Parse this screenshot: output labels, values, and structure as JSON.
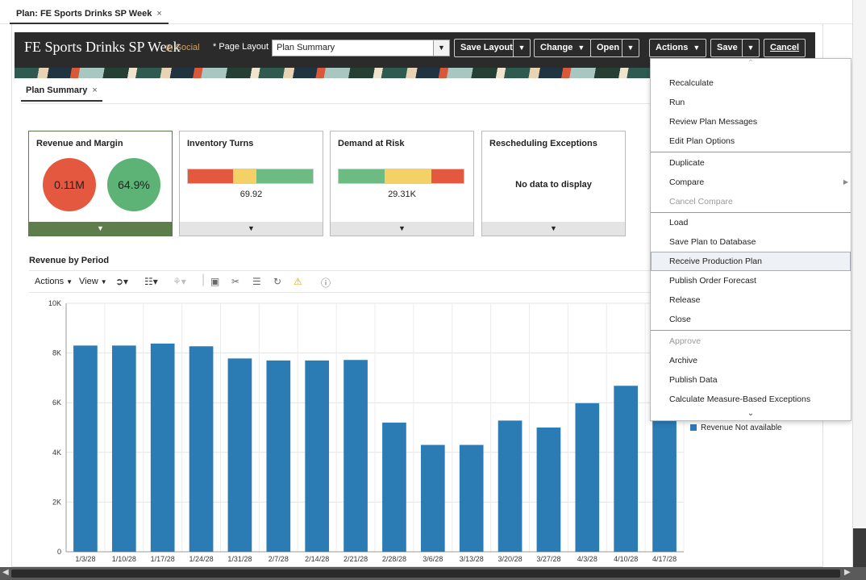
{
  "outer_tab": {
    "label": "Plan: FE Sports Drinks SP Week",
    "close": "×"
  },
  "header": {
    "title": "FE Sports Drinks SP Week",
    "social": "Social",
    "layout_label": "* Page Layout",
    "layout_value": "Plan Summary",
    "buttons": {
      "save_layout": "Save Layout",
      "change": "Change",
      "open": "Open",
      "actions": "Actions",
      "save": "Save",
      "cancel": "Cancel"
    }
  },
  "inner_tab": {
    "label": "Plan Summary",
    "close": "×"
  },
  "tiles": {
    "revenue": {
      "title": "Revenue and Margin",
      "revenue": "0.11M",
      "margin": "64.9%"
    },
    "inventory": {
      "title": "Inventory Turns",
      "value": "69.92"
    },
    "demand": {
      "title": "Demand at Risk",
      "value": "29.31K"
    },
    "rescheduling": {
      "title": "Rescheduling Exceptions",
      "empty": "No data to display"
    }
  },
  "chart_section": {
    "title": "Revenue by Period",
    "toolbar": {
      "actions": "Actions",
      "view": "View"
    }
  },
  "chart_data": {
    "type": "bar",
    "title": "",
    "categories": [
      "1/3/28",
      "1/10/28",
      "1/17/28",
      "1/24/28",
      "1/31/28",
      "2/7/28",
      "2/14/28",
      "2/21/28",
      "2/28/28",
      "3/6/28",
      "3/13/28",
      "3/20/28",
      "3/27/28",
      "4/3/28",
      "4/10/28",
      "4/17/28"
    ],
    "values": [
      8300,
      8300,
      8380,
      8270,
      7780,
      7700,
      7700,
      7720,
      5200,
      4300,
      4300,
      5280,
      5000,
      5980,
      6680,
      5700
    ],
    "ylim": [
      0,
      10000
    ],
    "yticks": [
      "0",
      "2K",
      "4K",
      "6K",
      "8K",
      "10K"
    ],
    "legend": "Revenue Not available",
    "color": "#2b7bb5",
    "grid": true
  },
  "menu": {
    "items": [
      {
        "label": "Recalculate",
        "disabled": false
      },
      {
        "label": "Run",
        "disabled": false
      },
      {
        "label": "Review Plan Messages",
        "disabled": false
      },
      {
        "label": "Edit Plan Options",
        "disabled": false
      },
      {
        "label": "Duplicate",
        "disabled": false
      },
      {
        "label": "Compare",
        "disabled": false
      },
      {
        "label": "Cancel Compare",
        "disabled": true
      },
      {
        "label": "Load",
        "disabled": false
      },
      {
        "label": "Save Plan to Database",
        "disabled": false
      },
      {
        "label": "Receive Production Plan",
        "disabled": false
      },
      {
        "label": "Publish Order Forecast",
        "disabled": false
      },
      {
        "label": "Release",
        "disabled": false
      },
      {
        "label": "Close",
        "disabled": false
      },
      {
        "label": "Approve",
        "disabled": true
      },
      {
        "label": "Archive",
        "disabled": false
      },
      {
        "label": "Publish Data",
        "disabled": false
      },
      {
        "label": "Calculate Measure-Based Exceptions",
        "disabled": false
      }
    ]
  }
}
